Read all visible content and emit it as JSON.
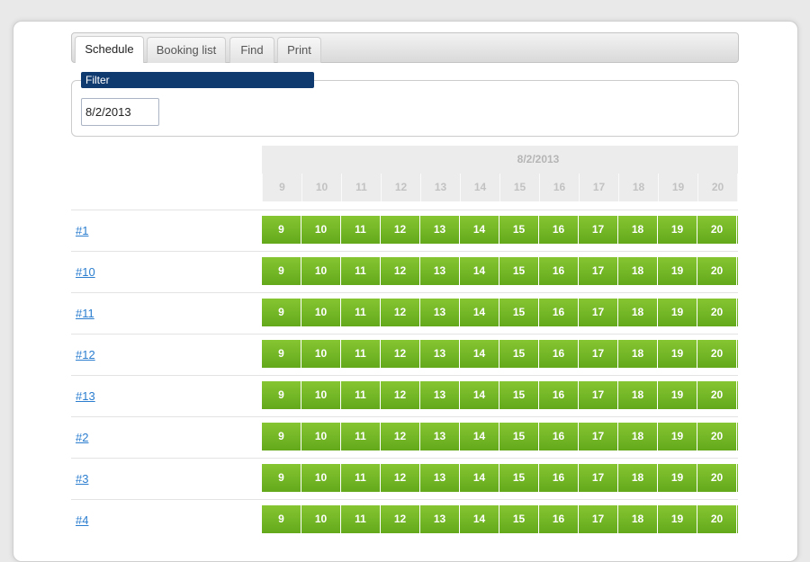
{
  "tabs": [
    {
      "label": "Schedule",
      "active": true
    },
    {
      "label": "Booking list",
      "active": false
    },
    {
      "label": "Find",
      "active": false
    },
    {
      "label": "Print",
      "active": false
    }
  ],
  "filter": {
    "legend": "Filter",
    "date_value": "8/2/2013"
  },
  "schedule": {
    "date": "8/2/2013",
    "hours": [
      "9",
      "10",
      "11",
      "12",
      "13",
      "14",
      "15",
      "16",
      "17",
      "18",
      "19",
      "20"
    ],
    "rooms": [
      "#1",
      "#10",
      "#11",
      "#12",
      "#13",
      "#2",
      "#3",
      "#4"
    ]
  },
  "colors": {
    "slot_green": "#74b727",
    "legend_blue": "#0f3a6f",
    "link_blue": "#2a7dcf"
  }
}
